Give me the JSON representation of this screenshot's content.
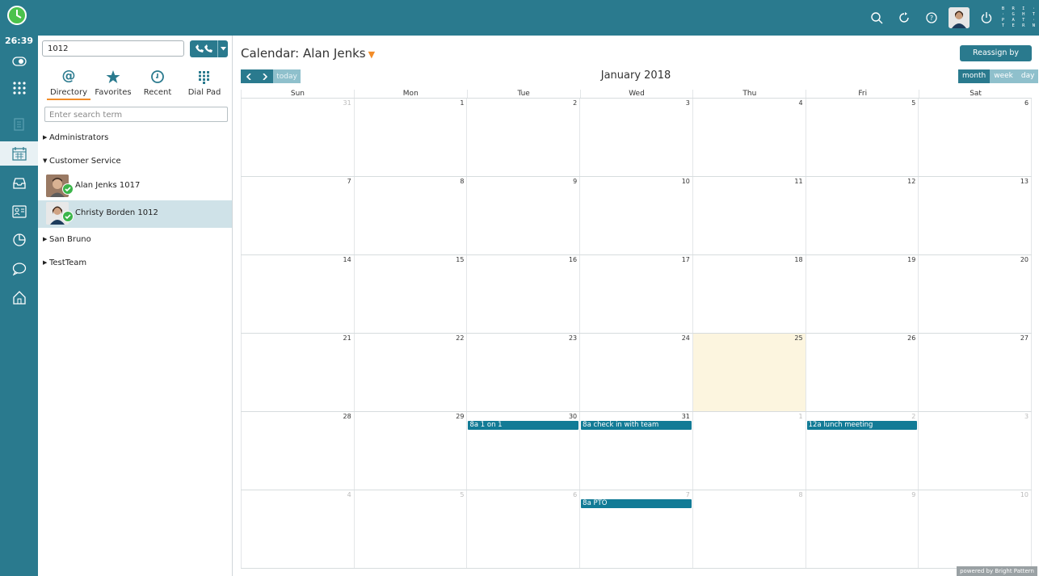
{
  "topbar": {
    "icons": [
      "search-icon",
      "refresh-icon",
      "help-icon",
      "user-avatar",
      "power-icon"
    ],
    "logo_lines": [
      "B R I ·",
      "· G H T",
      "P A T ·",
      "T E R N"
    ],
    "accent": "#2a7a8e"
  },
  "leftnav": {
    "timer": "26:39",
    "items": [
      "toggle-icon",
      "apps-grid-icon",
      "document-icon",
      "calendar-icon",
      "inbox-icon",
      "contacts-card-icon",
      "reports-pie-icon",
      "chat-bubble-icon",
      "home-icon"
    ]
  },
  "panel": {
    "search_value": "1012",
    "tabs": [
      {
        "label": "Directory",
        "icon": "at-icon"
      },
      {
        "label": "Favorites",
        "icon": "star-icon"
      },
      {
        "label": "Recent",
        "icon": "recent-icon"
      },
      {
        "label": "Dial Pad",
        "icon": "dialpad-icon"
      }
    ],
    "dir_search_placeholder": "Enter search term",
    "groups": [
      {
        "name": "Administrators",
        "expanded": false
      },
      {
        "name": "Customer Service",
        "expanded": true
      },
      {
        "name": "San Bruno",
        "expanded": false
      },
      {
        "name": "TestTeam",
        "expanded": false
      }
    ],
    "contacts": [
      {
        "name": "Alan Jenks 1017",
        "status": "available"
      },
      {
        "name": "Christy Borden 1012",
        "status": "available",
        "selected": true
      }
    ]
  },
  "calendar": {
    "title": "Calendar:",
    "owner": "Alan Jenks",
    "reassign_label": "Reassign by range...",
    "today_label": "today",
    "month_title": "January 2018",
    "views": [
      "month",
      "week",
      "day"
    ],
    "active_view": "month",
    "days_of_week": [
      "Sun",
      "Mon",
      "Tue",
      "Wed",
      "Thu",
      "Fri",
      "Sat"
    ],
    "weeks": [
      [
        {
          "d": "31",
          "o": true
        },
        {
          "d": "1"
        },
        {
          "d": "2"
        },
        {
          "d": "3"
        },
        {
          "d": "4"
        },
        {
          "d": "5"
        },
        {
          "d": "6"
        }
      ],
      [
        {
          "d": "7"
        },
        {
          "d": "8"
        },
        {
          "d": "9"
        },
        {
          "d": "10"
        },
        {
          "d": "11"
        },
        {
          "d": "12"
        },
        {
          "d": "13"
        }
      ],
      [
        {
          "d": "14"
        },
        {
          "d": "15"
        },
        {
          "d": "16"
        },
        {
          "d": "17"
        },
        {
          "d": "18"
        },
        {
          "d": "19"
        },
        {
          "d": "20"
        }
      ],
      [
        {
          "d": "21"
        },
        {
          "d": "22"
        },
        {
          "d": "23"
        },
        {
          "d": "24"
        },
        {
          "d": "25",
          "today": true
        },
        {
          "d": "26"
        },
        {
          "d": "27"
        }
      ],
      [
        {
          "d": "28"
        },
        {
          "d": "29"
        },
        {
          "d": "30",
          "ev": "8a 1 on 1"
        },
        {
          "d": "31",
          "ev": "8a check in with team"
        },
        {
          "d": "1",
          "o": true
        },
        {
          "d": "2",
          "o": true,
          "ev": "12a lunch meeting"
        },
        {
          "d": "3",
          "o": true
        }
      ],
      [
        {
          "d": "4",
          "o": true
        },
        {
          "d": "5",
          "o": true
        },
        {
          "d": "6",
          "o": true
        },
        {
          "d": "7",
          "o": true,
          "ev": "8a PTO"
        },
        {
          "d": "8",
          "o": true
        },
        {
          "d": "9",
          "o": true
        },
        {
          "d": "10",
          "o": true
        }
      ]
    ],
    "powered_by": "powered by Bright Pattern"
  }
}
